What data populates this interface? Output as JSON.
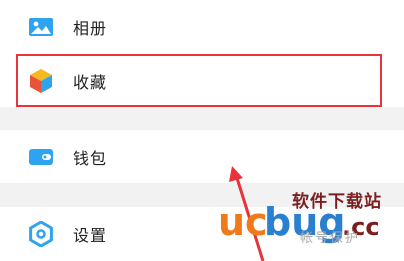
{
  "menu": {
    "items": [
      {
        "label": "相册",
        "icon": "gallery-icon",
        "color": "#2ea3ef"
      },
      {
        "label": "收藏",
        "icon": "cube-icon",
        "color": "#f5b820"
      },
      {
        "label": "钱包",
        "icon": "wallet-icon",
        "color": "#2ea3ef"
      },
      {
        "label": "设置",
        "icon": "gear-icon",
        "color": "#2ea3ef"
      }
    ],
    "highlighted_index": 1
  },
  "annotation": {
    "highlight_color": "#e8333a"
  },
  "watermark": {
    "site_name": "软件下载站",
    "logo_text": "ucbug.cc",
    "sub_text": "帐号保护"
  }
}
